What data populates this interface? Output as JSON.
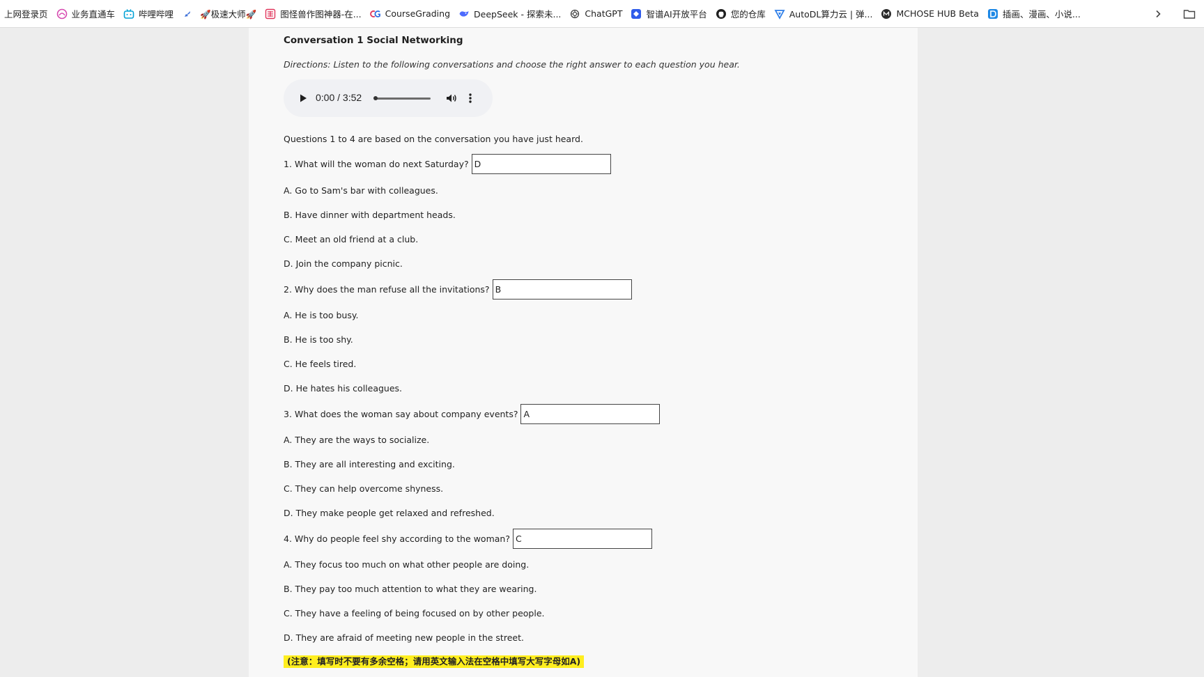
{
  "bookmarks": [
    {
      "label": "上网登录页",
      "icon": "none"
    },
    {
      "label": "业务直通车",
      "icon": "circle-logo-icon"
    },
    {
      "label": "哔哩哔哩",
      "icon": "bilibili-icon"
    },
    {
      "label": "",
      "icon": "rocket-icon"
    },
    {
      "label": "🚀极速大师🚀",
      "icon": "none"
    },
    {
      "label": "图怪兽作图神器-在...",
      "icon": "grid-logo-icon"
    },
    {
      "label": "CourseGrading",
      "icon": "cg-logo-icon"
    },
    {
      "label": "DeepSeek - 探索未...",
      "icon": "deepseek-icon"
    },
    {
      "label": "ChatGPT",
      "icon": "chatgpt-icon"
    },
    {
      "label": "智谱AI开放平台",
      "icon": "zhipu-icon"
    },
    {
      "label": "您的仓库",
      "icon": "github-icon"
    },
    {
      "label": "AutoDL算力云 | 弹...",
      "icon": "autodl-icon"
    },
    {
      "label": "MCHOSE HUB Beta",
      "icon": "mchose-icon"
    },
    {
      "label": "插画、漫画、小说...",
      "icon": "d-logo-icon"
    }
  ],
  "content": {
    "title": "Conversation 1 Social Networking",
    "directions": "Directions: Listen to the following conversations and choose the right answer to each question you hear.",
    "audio": {
      "current": "0:00",
      "separator": " / ",
      "duration": "3:52",
      "progress": 0
    },
    "intro": "Questions 1 to 4 are based on the conversation you have just heard.",
    "questions": [
      {
        "prompt": "1. What will the woman do next Saturday?",
        "answer": "D",
        "options": [
          "A. Go to Sam's bar with colleagues.",
          "B. Have dinner with department heads.",
          "C. Meet an old friend at a club.",
          "D. Join the company picnic."
        ]
      },
      {
        "prompt": "2. Why does the man refuse all the invitations?",
        "answer": "B",
        "options": [
          "A. He is too busy.",
          "B. He is too shy.",
          "C. He feels tired.",
          "D. He hates his colleagues."
        ]
      },
      {
        "prompt": "3. What does the woman say about company events?",
        "answer": "A",
        "options": [
          "A. They are the ways to socialize.",
          "B. They are all interesting and exciting.",
          "C. They can help overcome shyness.",
          "D. They make people get relaxed and refreshed."
        ]
      },
      {
        "prompt": "4. Why do people feel shy according to the woman?",
        "answer": "C",
        "options": [
          "A. They focus too much on what other people are doing.",
          "B. They pay too much attention to what they are wearing.",
          "C. They have a feeling of being focused on by other people.",
          "D. They are afraid of meeting new people in the street."
        ]
      }
    ],
    "note": "(注意：填写时不要有多余空格；请用英文输入法在空格中填写大写字母如A)"
  },
  "colors": {
    "page_bg": "#f8f8f8",
    "outer_bg": "#ededed",
    "note_highlight": "#ffee1f",
    "player_bg": "#f0f1f4"
  }
}
